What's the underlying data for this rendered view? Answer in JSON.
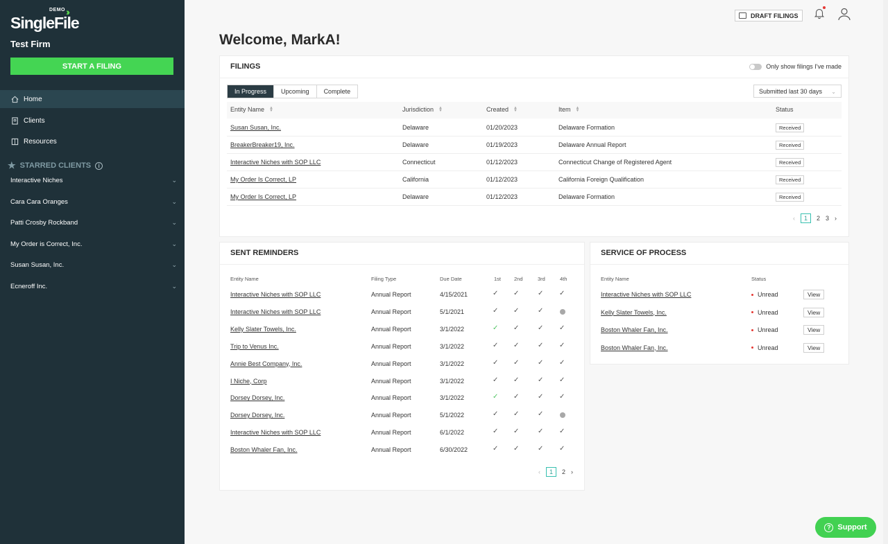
{
  "sidebar": {
    "logo_demo": "DEMO",
    "logo_text": "SingleFile",
    "firm": "Test Firm",
    "start_btn": "START A FILING",
    "nav": [
      {
        "label": "Home",
        "icon": "home-icon"
      },
      {
        "label": "Clients",
        "icon": "clients-icon"
      },
      {
        "label": "Resources",
        "icon": "resources-icon"
      }
    ],
    "starred_label": "STARRED CLIENTS",
    "clients": [
      "Interactive Niches",
      "Cara Cara Oranges",
      "Patti Crosby Rockband",
      "My Order is Correct, Inc.",
      "Susan Susan, Inc.",
      "Ecneroff Inc."
    ]
  },
  "topbar": {
    "draft_label": "DRAFT FILINGS"
  },
  "welcome": "Welcome, MarkA!",
  "filings": {
    "title": "FILINGS",
    "toggle_label": "Only show filings I've made",
    "tabs": [
      "In Progress",
      "Upcoming",
      "Complete"
    ],
    "filter": "Submitted last 30 days",
    "headers": [
      "Entity Name",
      "Jurisdiction",
      "Created",
      "Item",
      "Status"
    ],
    "rows": [
      [
        "Susan Susan, Inc.",
        "Delaware",
        "01/20/2023",
        "Delaware Formation",
        "Received"
      ],
      [
        "BreakerBreaker19, Inc.",
        "Delaware",
        "01/19/2023",
        "Delaware Annual Report",
        "Received"
      ],
      [
        "Interactive Niches with SOP LLC",
        "Connecticut",
        "01/12/2023",
        "Connecticut Change of Registered Agent",
        "Received"
      ],
      [
        "My Order Is Correct, LP",
        "California",
        "01/12/2023",
        "California Foreign Qualification",
        "Received"
      ],
      [
        "My Order Is Correct, LP",
        "Delaware",
        "01/12/2023",
        "Delaware Formation",
        "Received"
      ]
    ],
    "pages": [
      "1",
      "2",
      "3"
    ]
  },
  "reminders": {
    "title": "SENT REMINDERS",
    "headers": [
      "Entity Name",
      "Filing Type",
      "Due Date",
      "1st",
      "2nd",
      "3rd",
      "4th"
    ],
    "rows": [
      {
        "entity": "Interactive Niches with SOP LLC",
        "type": "Annual Report",
        "due": "4/15/2021",
        "marks": [
          "c",
          "c",
          "c",
          "c"
        ]
      },
      {
        "entity": "Interactive Niches with SOP LLC",
        "type": "Annual Report",
        "due": "5/1/2021",
        "marks": [
          "c",
          "c",
          "c",
          "d"
        ]
      },
      {
        "entity": "Kelly Slater Towels, Inc.",
        "type": "Annual Report",
        "due": "3/1/2022",
        "marks": [
          "g",
          "c",
          "c",
          "c"
        ]
      },
      {
        "entity": "Trip to Venus Inc.",
        "type": "Annual Report",
        "due": "3/1/2022",
        "marks": [
          "c",
          "c",
          "c",
          "c"
        ]
      },
      {
        "entity": "Annie Best Company, Inc.",
        "type": "Annual Report",
        "due": "3/1/2022",
        "marks": [
          "c",
          "c",
          "c",
          "c"
        ]
      },
      {
        "entity": "I Niche, Corp",
        "type": "Annual Report",
        "due": "3/1/2022",
        "marks": [
          "c",
          "c",
          "c",
          "c"
        ]
      },
      {
        "entity": "Dorsey Dorsey, Inc.",
        "type": "Annual Report",
        "due": "3/1/2022",
        "marks": [
          "g",
          "c",
          "c",
          "c"
        ]
      },
      {
        "entity": "Dorsey Dorsey, Inc.",
        "type": "Annual Report",
        "due": "5/1/2022",
        "marks": [
          "c",
          "c",
          "c",
          "d"
        ]
      },
      {
        "entity": "Interactive Niches with SOP LLC",
        "type": "Annual Report",
        "due": "6/1/2022",
        "marks": [
          "c",
          "c",
          "c",
          "c"
        ]
      },
      {
        "entity": "Boston Whaler Fan, Inc.",
        "type": "Annual Report",
        "due": "6/30/2022",
        "marks": [
          "c",
          "c",
          "c",
          "c"
        ]
      }
    ],
    "pages": [
      "1",
      "2"
    ]
  },
  "sop": {
    "title": "SERVICE OF PROCESS",
    "headers": [
      "Entity Name",
      "Status"
    ],
    "rows": [
      {
        "entity": "Interactive Niches with SOP LLC",
        "status": "Unread",
        "action": "View"
      },
      {
        "entity": "Kelly Slater Towels, Inc.",
        "status": "Unread",
        "action": "View"
      },
      {
        "entity": "Boston Whaler Fan, Inc.",
        "status": "Unread",
        "action": "View"
      },
      {
        "entity": "Boston Whaler Fan, Inc.",
        "status": "Unread",
        "action": "View"
      }
    ]
  },
  "support_label": "Support",
  "colors": {
    "sidebar": "#1f3139",
    "accent_green": "#44d553",
    "tab_active": "#2b3c44"
  }
}
